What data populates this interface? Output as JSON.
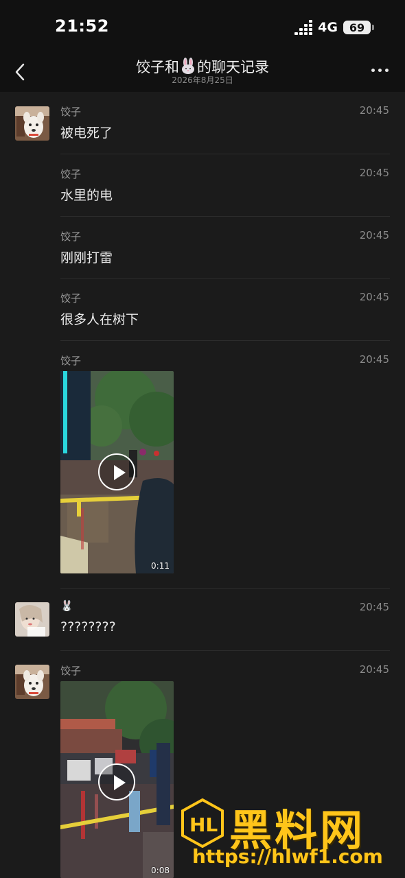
{
  "status_bar": {
    "time": "21:52",
    "network": "4G",
    "battery": "69"
  },
  "nav": {
    "title_prefix": "饺子和",
    "title_suffix": "的聊天记录",
    "subtitle": "2026年8月25日"
  },
  "messages": [
    {
      "sender": "饺子",
      "time": "20:45",
      "text": "被电死了"
    },
    {
      "sender": "饺子",
      "time": "20:45",
      "text": "水里的电"
    },
    {
      "sender": "饺子",
      "time": "20:45",
      "text": "刚刚打雷"
    },
    {
      "sender": "饺子",
      "time": "20:45",
      "text": "很多人在树下"
    },
    {
      "sender": "饺子",
      "time": "20:45",
      "video_duration": "0:11"
    },
    {
      "sender": "🐰",
      "time": "20:45",
      "text": "????????"
    },
    {
      "sender": "饺子",
      "time": "20:45",
      "video_duration": "0:08"
    }
  ],
  "watermark": {
    "name": "黑料网",
    "url": "https://hlwf1.com"
  },
  "colors": {
    "background": "#1b1b1b",
    "bar": "#111111",
    "watermark": "#ffc51a"
  }
}
